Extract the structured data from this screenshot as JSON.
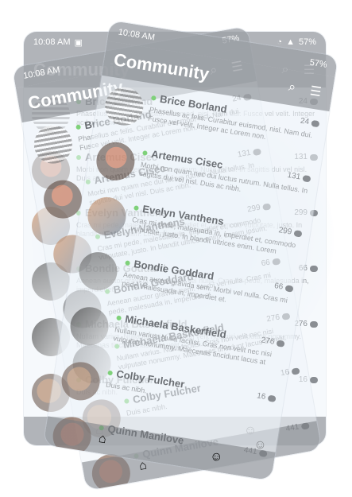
{
  "status": {
    "time": "10:08 AM",
    "battery": "57%"
  },
  "header": {
    "title": "Community"
  },
  "contacts": [
    {
      "name": "Brice Borland",
      "count": "24",
      "snippet": "Phasellus ac felis. Curabitur euismod, nisl. Nam dui. Fusce vel velit. Integer ac Lorem non."
    },
    {
      "name": "Artemus Cisec",
      "count": "131",
      "snippet": "Morbi non quam nec dui luctus rutrum. Nulla tellus. In sagittis dui vel nisl. Duis ac nibh."
    },
    {
      "name": "Evelyn Vanthens",
      "count": "299",
      "snippet": "Cras mi pede, malesuada in, imperdiet et, commodo vulputate, justo. In blandit ultrices enim. Lorem ipsum."
    },
    {
      "name": "Bondie Goddard",
      "count": "66",
      "snippet": "Aenean auctor gravida sem. Morbi vel nulla. Cras mi pede, malesuada in, imperdiet et."
    },
    {
      "name": "Michaela Baskerfield",
      "count": "276",
      "snippet": "Nullam varius. Nulla facilisi. Cras non velit nec nisi vulputate nonummy. Maecenas tincidunt lacus at velit."
    },
    {
      "name": "Colby Fulcher",
      "count": "16",
      "snippet": "Duis ac nibh."
    },
    {
      "name": "Quinn Manilove",
      "count": "441",
      "snippet": ""
    }
  ],
  "tabs": {
    "home": "home-icon",
    "profile": "profile-icon"
  }
}
